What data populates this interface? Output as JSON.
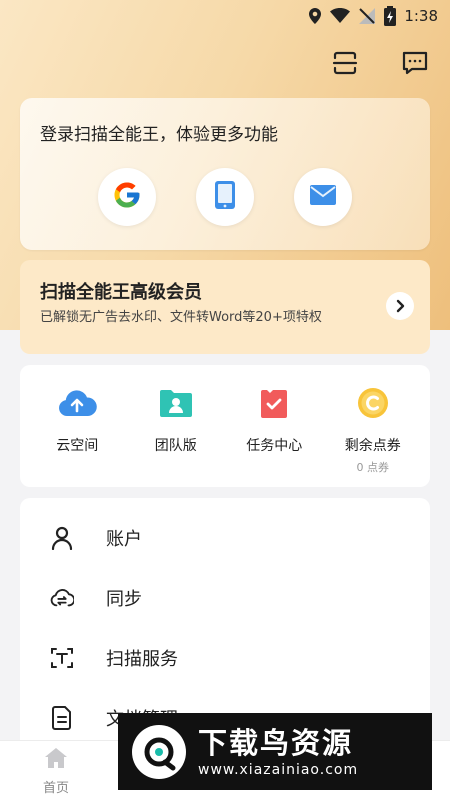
{
  "status": {
    "time": "1:38"
  },
  "colors": {
    "accent": "#19bcaa",
    "brand_gold": "#eebf7c",
    "blue": "#3d8fe8"
  },
  "top_icons": [
    "scan-icon",
    "message-icon"
  ],
  "login": {
    "title": "登录扫描全能王，体验更多功能",
    "options": [
      {
        "name": "google-login",
        "icon": "google-icon"
      },
      {
        "name": "phone-login",
        "icon": "phone-icon"
      },
      {
        "name": "email-login",
        "icon": "mail-icon"
      }
    ]
  },
  "vip": {
    "title": "扫描全能王高级会员",
    "subtitle": "已解锁无广告去水印、文件转Word等20+项特权"
  },
  "quick": [
    {
      "label": "云空间",
      "icon": "cloud-upload-icon"
    },
    {
      "label": "团队版",
      "icon": "team-folder-icon"
    },
    {
      "label": "任务中心",
      "icon": "task-icon"
    },
    {
      "label": "剩余点券",
      "sub": "0 点券",
      "icon": "coupon-icon"
    }
  ],
  "menu": [
    {
      "label": "账户",
      "icon": "user-icon"
    },
    {
      "label": "同步",
      "icon": "sync-cloud-icon"
    },
    {
      "label": "扫描服务",
      "icon": "scan-text-icon"
    },
    {
      "label": "文档管理",
      "icon": "document-icon"
    }
  ],
  "bottom_nav": {
    "home": "首页"
  },
  "watermark": {
    "cn": "下载鸟资源",
    "en": "www.xiazainiao.com"
  }
}
